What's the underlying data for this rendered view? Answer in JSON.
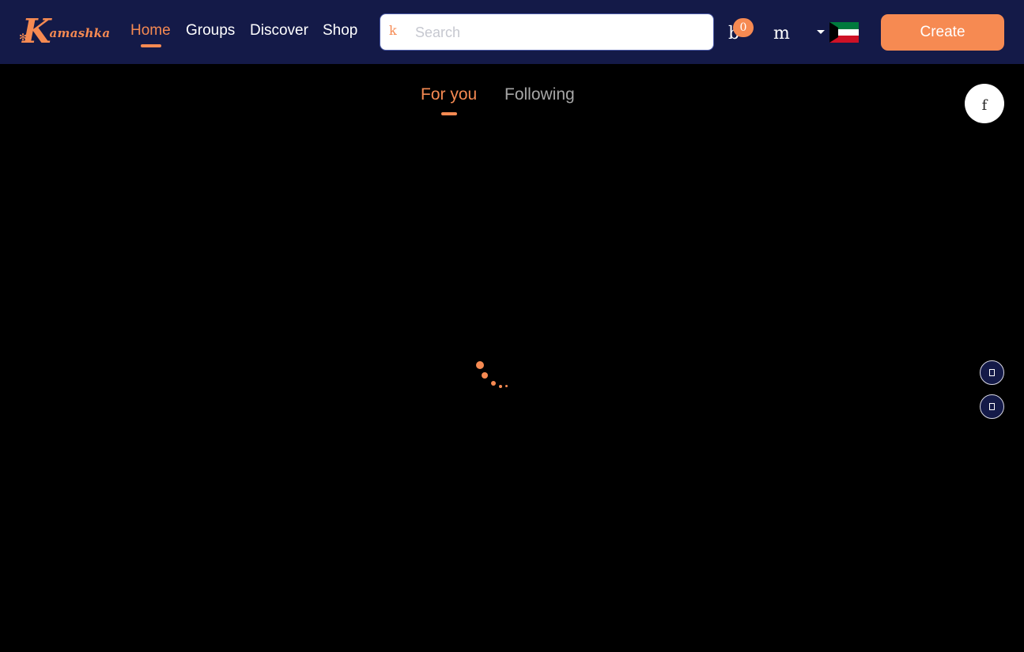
{
  "brand": {
    "logo_text": "Kamashka",
    "logo_initial": "K",
    "logo_rest": "amashka"
  },
  "nav": {
    "items": [
      {
        "label": "Home",
        "active": true
      },
      {
        "label": "Groups",
        "active": false
      },
      {
        "label": "Discover",
        "active": false
      },
      {
        "label": "Shop",
        "active": false
      }
    ]
  },
  "search": {
    "placeholder": "Search",
    "value": "",
    "icon_glyph": "k"
  },
  "header": {
    "notifications_glyph": "b",
    "notifications_count": "0",
    "messages_glyph": "m",
    "language_flag": "kuwait-flag",
    "create_label": "Create"
  },
  "feed": {
    "tabs": [
      {
        "label": "For you",
        "active": true
      },
      {
        "label": "Following",
        "active": false
      }
    ],
    "loading": true
  },
  "floating": {
    "circle_glyph": "f"
  },
  "colors": {
    "topbar": "#141a48",
    "accent": "#f68a52",
    "background": "#000000",
    "inactive_tab": "#a7a7a7"
  }
}
